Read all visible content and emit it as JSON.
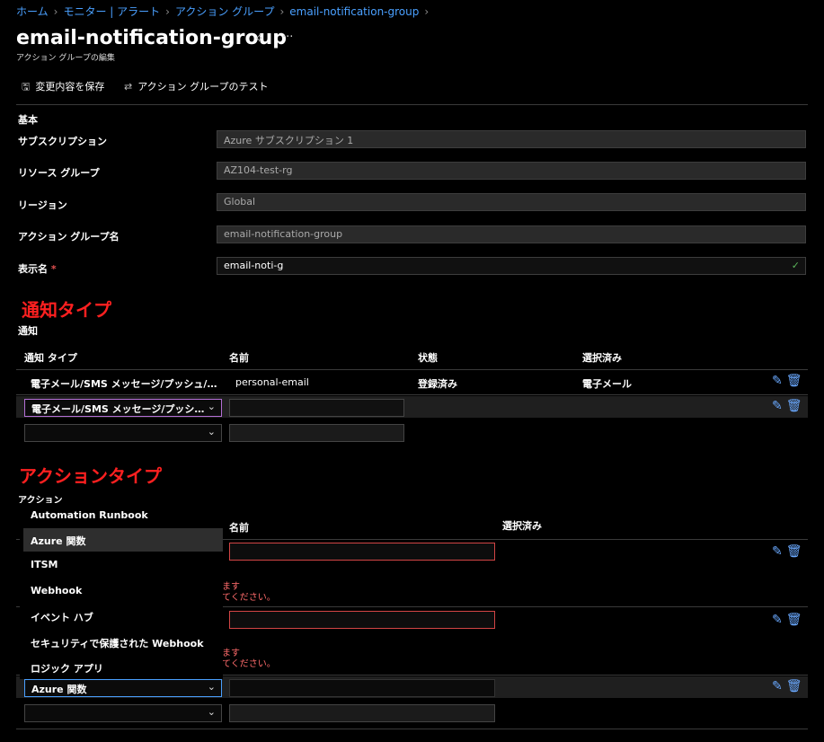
{
  "breadcrumb": [
    "ホーム",
    "モニター | アラート",
    "アクション グループ",
    "email-notification-group"
  ],
  "header": {
    "title": "email-notification-group",
    "subtitle": "アクション グループの編集"
  },
  "toolbar": {
    "save_label": "変更内容を保存",
    "test_label": "アクション グループのテスト"
  },
  "basics": {
    "section_label": "基本",
    "subscription_label": "サブスクリプション",
    "subscription_value": "Azure サブスクリプション 1",
    "resource_group_label": "リソース グループ",
    "resource_group_value": "AZ104-test-rg",
    "region_label": "リージョン",
    "region_value": "Global",
    "group_name_label": "アクション グループ名",
    "group_name_value": "email-notification-group",
    "display_name_label": "表示名",
    "display_name_required": "*",
    "display_name_value": "email-noti-g"
  },
  "notifications": {
    "annotation": "通知タイプ",
    "section_label": "通知",
    "headers": [
      "通知 タイプ",
      "名前",
      "状態",
      "選択済み"
    ],
    "row1": {
      "type": "電子メール/SMS メッセージ/プッシュ/…",
      "name": "personal-email",
      "status": "登録済み",
      "selected": "電子メール"
    },
    "row2_select": "電子メール/SMS メッセージ/プッシ…"
  },
  "actions": {
    "annotation": "アクションタイプ",
    "section_label": "アクション",
    "headers": [
      "名前",
      "選択済み"
    ],
    "error_line1": "ます",
    "error_line2": "てください。",
    "selected_type": "Azure 関数",
    "dropdown_options": [
      "Automation Runbook",
      "Azure 関数",
      "ITSM",
      "Webhook",
      "イベント ハブ",
      "セキュリティで保護された Webhook",
      "ロジック アプリ"
    ]
  },
  "colors": {
    "accent": "#4aa0ff",
    "annotation_red": "#ff2020",
    "error": "#d24545"
  }
}
